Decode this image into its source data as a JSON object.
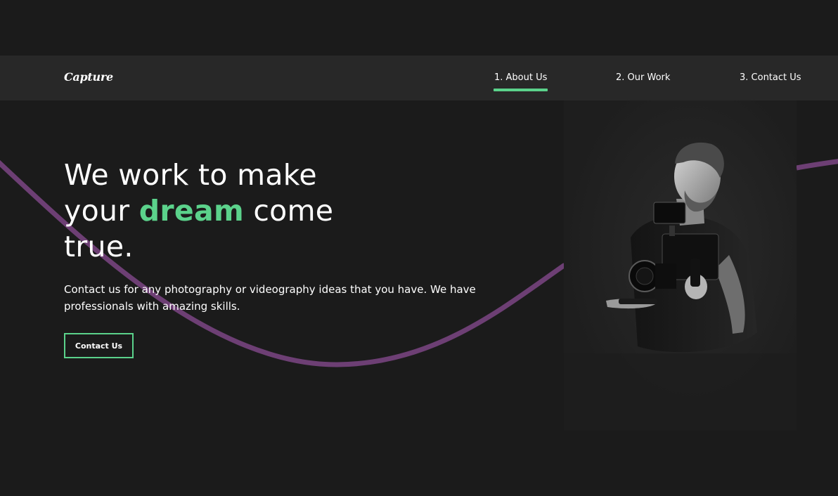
{
  "nav": {
    "logo": "Capture",
    "links": [
      {
        "label": "1. About Us",
        "active": true
      },
      {
        "label": "2. Our Work",
        "active": false
      },
      {
        "label": "3. Contact Us",
        "active": false
      }
    ]
  },
  "hero": {
    "title_line1": "We work to make",
    "title_line2_before": "your",
    "title_line2_accent": "dream",
    "title_line2_after": "come",
    "title_line3": "true.",
    "description": "Contact us for any photography or videography ideas that you have. We have professionals with amazing skills.",
    "button_label": "Contact Us"
  },
  "colors": {
    "background": "#1b1b1b",
    "navbar": "#282828",
    "accent_green": "#5bd28b",
    "wave_purple": "#6d3f74",
    "text": "#ffffff"
  },
  "icons": {
    "hero_image": "photographer-with-camera-image"
  }
}
